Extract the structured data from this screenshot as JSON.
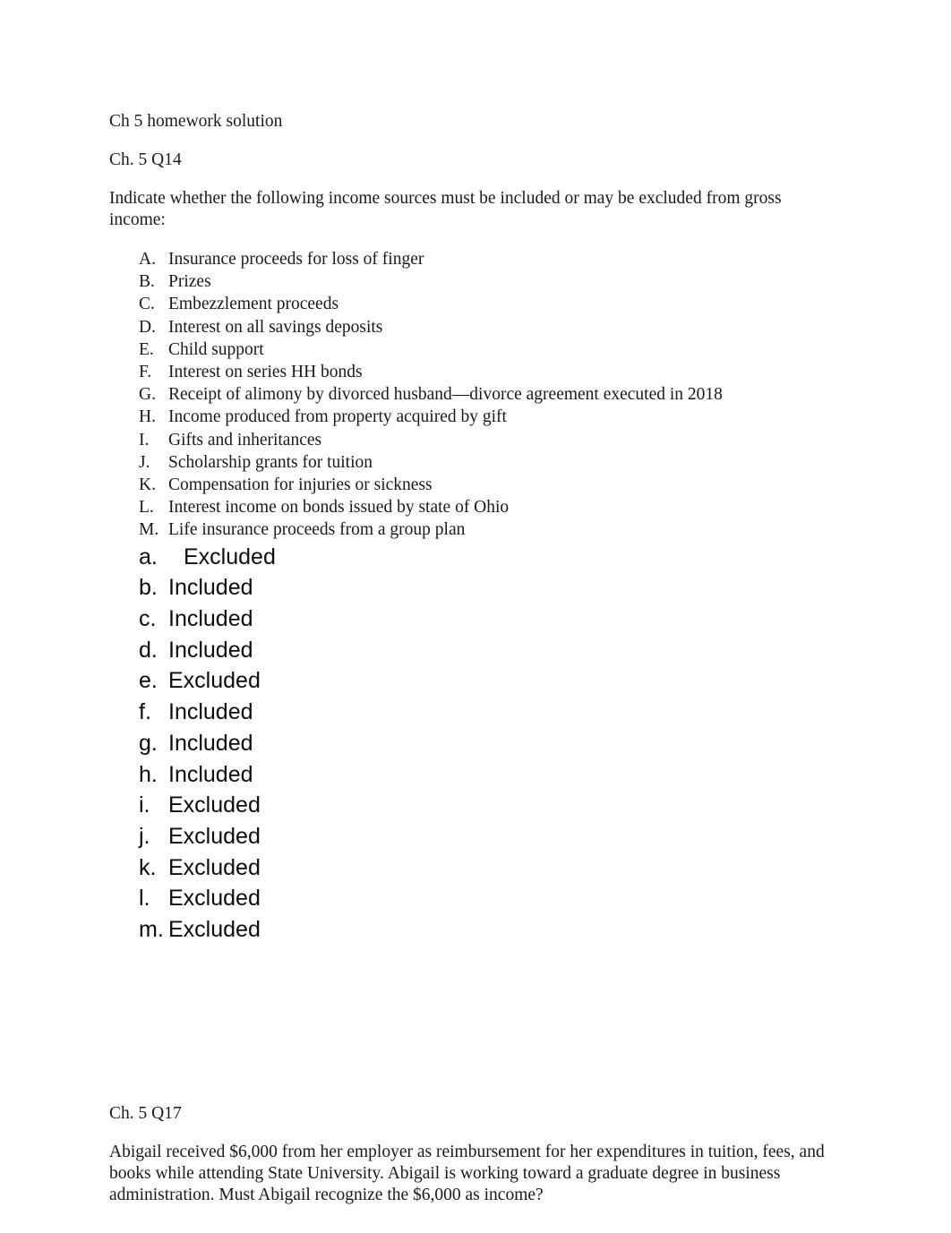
{
  "document": {
    "title": "Ch 5 homework solution",
    "sections": [
      {
        "heading": "Ch. 5 Q14",
        "prompt": "Indicate whether the following income sources must be included or may be excluded from gross income:",
        "items": [
          {
            "marker": "A.",
            "text": "Insurance proceeds for loss of finger"
          },
          {
            "marker": "B.",
            "text": "Prizes"
          },
          {
            "marker": "C.",
            "text": "Embezzlement proceeds"
          },
          {
            "marker": "D.",
            "text": "Interest on all savings deposits"
          },
          {
            "marker": "E.",
            "text": "Child support"
          },
          {
            "marker": "F.",
            "text": "Interest on series HH bonds"
          },
          {
            "marker": "G.",
            "text": "Receipt of alimony by divorced husband—divorce agreement executed in 2018"
          },
          {
            "marker": "H.",
            "text": "Income produced from property acquired by gift"
          },
          {
            "marker": "I.",
            "text": "Gifts and inheritances"
          },
          {
            "marker": "J.",
            "text": "Scholarship grants for tuition"
          },
          {
            "marker": "K.",
            "text": "Compensation for injuries or sickness"
          },
          {
            "marker": "L.",
            "text": "Interest income on bonds issued by state of Ohio"
          },
          {
            "marker": "M.",
            "text": "Life insurance proceeds from a group plan"
          }
        ],
        "answers": [
          {
            "marker": "a.",
            "text": "Excluded",
            "extra_indent": true
          },
          {
            "marker": "b.",
            "text": "Included",
            "extra_indent": false
          },
          {
            "marker": "c.",
            "text": "Included",
            "extra_indent": false
          },
          {
            "marker": "d.",
            "text": "Included",
            "extra_indent": false
          },
          {
            "marker": "e.",
            "text": "Excluded",
            "extra_indent": false
          },
          {
            "marker": "f.",
            "text": "Included",
            "extra_indent": false
          },
          {
            "marker": "g.",
            "text": "Included",
            "extra_indent": false
          },
          {
            "marker": "h.",
            "text": "Included",
            "extra_indent": false
          },
          {
            "marker": "i.",
            "text": "Excluded",
            "extra_indent": false
          },
          {
            "marker": "j.",
            "text": "Excluded",
            "extra_indent": false
          },
          {
            "marker": "k.",
            "text": "Excluded",
            "extra_indent": false
          },
          {
            "marker": "l.",
            "text": "Excluded",
            "extra_indent": false
          },
          {
            "marker": "m.",
            "text": "Excluded",
            "extra_indent": false
          }
        ]
      },
      {
        "heading": "Ch. 5 Q17",
        "prompt": "Abigail received $6,000 from her employer as reimbursement for her expenditures in tuition, fees, and books while attending State University. Abigail is working toward a graduate degree in business administration. Must Abigail recognize the $6,000 as income?"
      }
    ]
  }
}
